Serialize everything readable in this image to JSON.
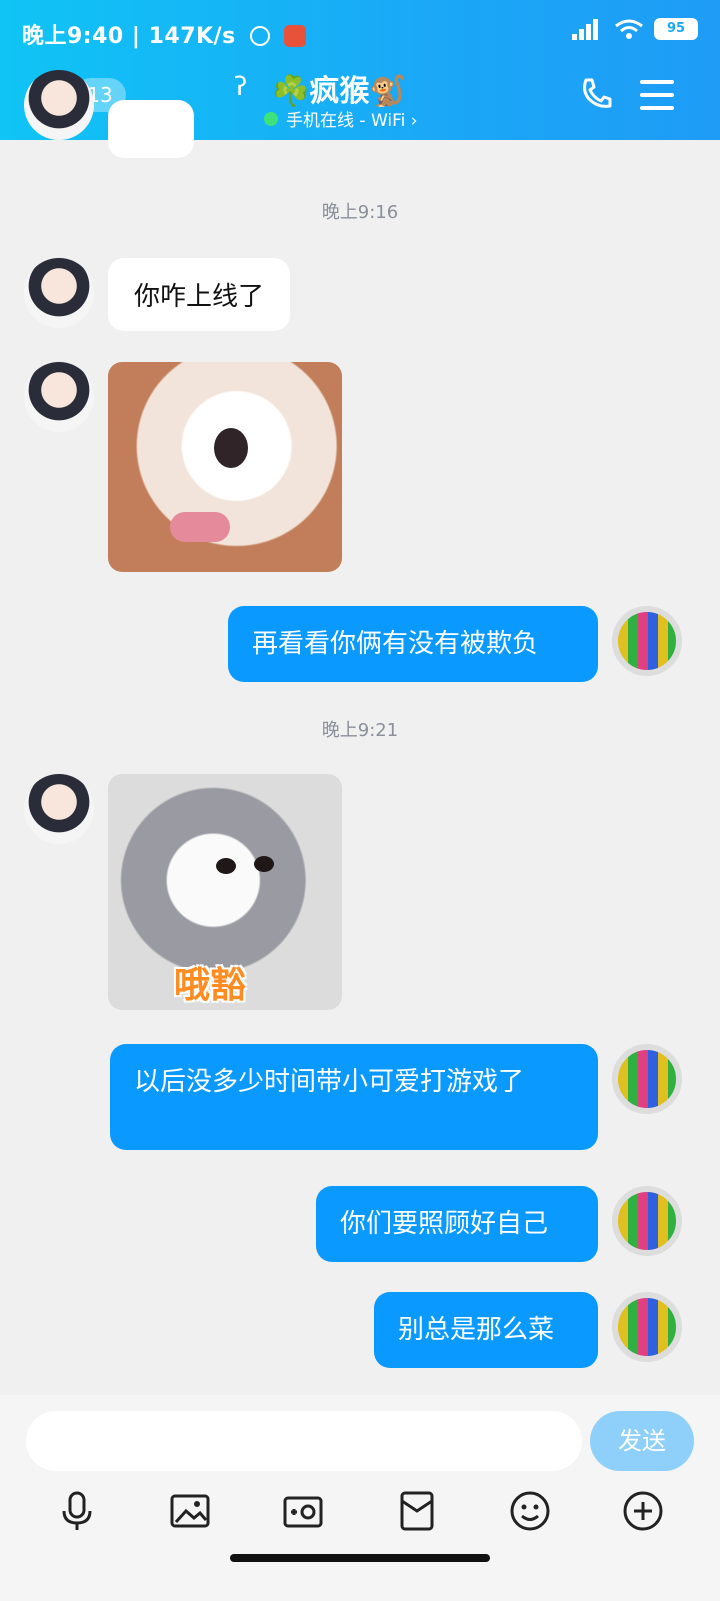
{
  "status_bar": {
    "time_speed": "晚上9:40 | 147K/s",
    "battery": "95"
  },
  "header": {
    "unread_count": "13",
    "contact_name": "☘️疯猴🐒",
    "presence": "手机在线 - WiFi ›"
  },
  "messages": {
    "time1": "晚上9:16",
    "m1": "你咋上线了",
    "m2": "再看看你俩有没有被欺负",
    "time2": "晚上9:21",
    "sticker_caption": "哦豁",
    "m3": "以后没多少时间带小可爱打游戏了",
    "m4": "你们要照顾好自己",
    "m5": "别总是那么菜"
  },
  "composer": {
    "input_value": "",
    "send_label": "发送"
  },
  "toolbar": {
    "icons": [
      "mic-icon",
      "image-icon",
      "camera-icon",
      "red-packet-icon",
      "emoji-icon",
      "plus-icon"
    ]
  },
  "colors": {
    "header": "#1aa8f7",
    "outgoing_bubble": "#0a99ff",
    "send_button": "#8fd0fb"
  }
}
